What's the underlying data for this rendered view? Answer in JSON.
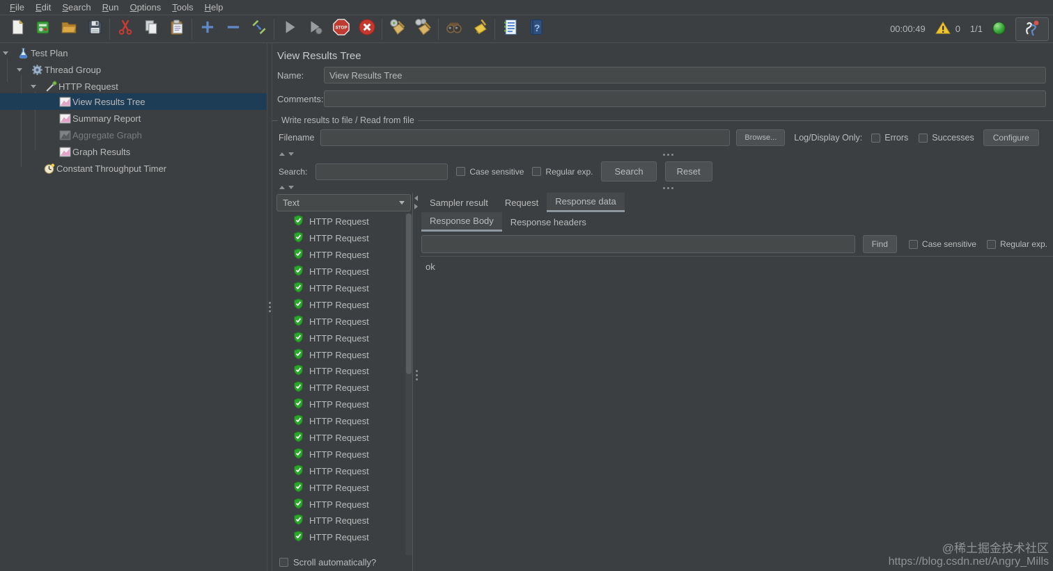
{
  "menu": {
    "items": [
      "File",
      "Edit",
      "Search",
      "Run",
      "Options",
      "Tools",
      "Help"
    ]
  },
  "toolbar": {
    "icons": [
      "new-file-icon",
      "templates-icon",
      "open-folder-icon",
      "save-icon",
      "cut-icon",
      "copy-icon",
      "paste-icon",
      "add-icon",
      "remove-icon",
      "toggle-icon",
      "start-icon",
      "start-no-pauses-icon",
      "stop-icon",
      "shutdown-icon",
      "clear-icon",
      "clear-all-icon",
      "search-icon",
      "search-reset-icon",
      "function-helper-icon",
      "help-icon",
      "remote-start-icon"
    ],
    "stop_label": "STOP",
    "help_glyph": "?",
    "timer": "00:00:49",
    "warning_count": "0",
    "threads": "1/1"
  },
  "tree": {
    "nodes": [
      {
        "label": "Test Plan"
      },
      {
        "label": "Thread Group"
      },
      {
        "label": "HTTP Request"
      },
      {
        "label": "View Results Tree"
      },
      {
        "label": "Summary Report"
      },
      {
        "label": "Aggregate Graph"
      },
      {
        "label": "Graph Results"
      },
      {
        "label": "Constant Throughput Timer"
      }
    ],
    "selected": "View Results Tree",
    "disabled": "Aggregate Graph"
  },
  "main": {
    "title": "View Results Tree",
    "name_label": "Name:",
    "name_value": "View Results Tree",
    "comments_label": "Comments:",
    "comments_value": "",
    "file_section": {
      "title": "Write results to file / Read from file",
      "filename_label": "Filename",
      "filename_value": "",
      "browse_button": "Browse...",
      "log_display_label": "Log/Display Only:",
      "errors_label": "Errors",
      "successes_label": "Successes",
      "configure_button": "Configure"
    },
    "search_bar": {
      "label": "Search:",
      "value": "",
      "case_sensitive_label": "Case sensitive",
      "regular_exp_label": "Regular exp.",
      "search_button": "Search",
      "reset_button": "Reset"
    },
    "results": {
      "renderer": "Text",
      "items": [
        "HTTP Request",
        "HTTP Request",
        "HTTP Request",
        "HTTP Request",
        "HTTP Request",
        "HTTP Request",
        "HTTP Request",
        "HTTP Request",
        "HTTP Request",
        "HTTP Request",
        "HTTP Request",
        "HTTP Request",
        "HTTP Request",
        "HTTP Request",
        "HTTP Request",
        "HTTP Request",
        "HTTP Request",
        "HTTP Request",
        "HTTP Request",
        "HTTP Request"
      ],
      "scroll_label": "Scroll automatically?"
    },
    "tabs": {
      "items": [
        "Sampler result",
        "Request",
        "Response data"
      ],
      "selected": "Response data"
    },
    "subtabs": {
      "items": [
        "Response Body",
        "Response headers"
      ],
      "selected": "Response Body"
    },
    "find_bar": {
      "value": "",
      "find_button": "Find",
      "case_sensitive_label": "Case sensitive",
      "regular_exp_label": "Regular exp."
    },
    "response_body": "ok"
  },
  "watermark": {
    "line1": "@稀土掘金技术社区",
    "line2": "https://blog.csdn.net/Angry_Mills"
  },
  "colors": {
    "background": "#3c3f41",
    "field_background": "#45494a",
    "border": "#5e6163",
    "text": "#bbbbbb",
    "list_selection": "#4b6eaf",
    "tree_selection": "#1d3c55",
    "success_green": "#2ea52e",
    "stop_red": "#c0392b",
    "warning_yellow": "#f5c52e",
    "accent_blue": "#5f8ac7"
  }
}
